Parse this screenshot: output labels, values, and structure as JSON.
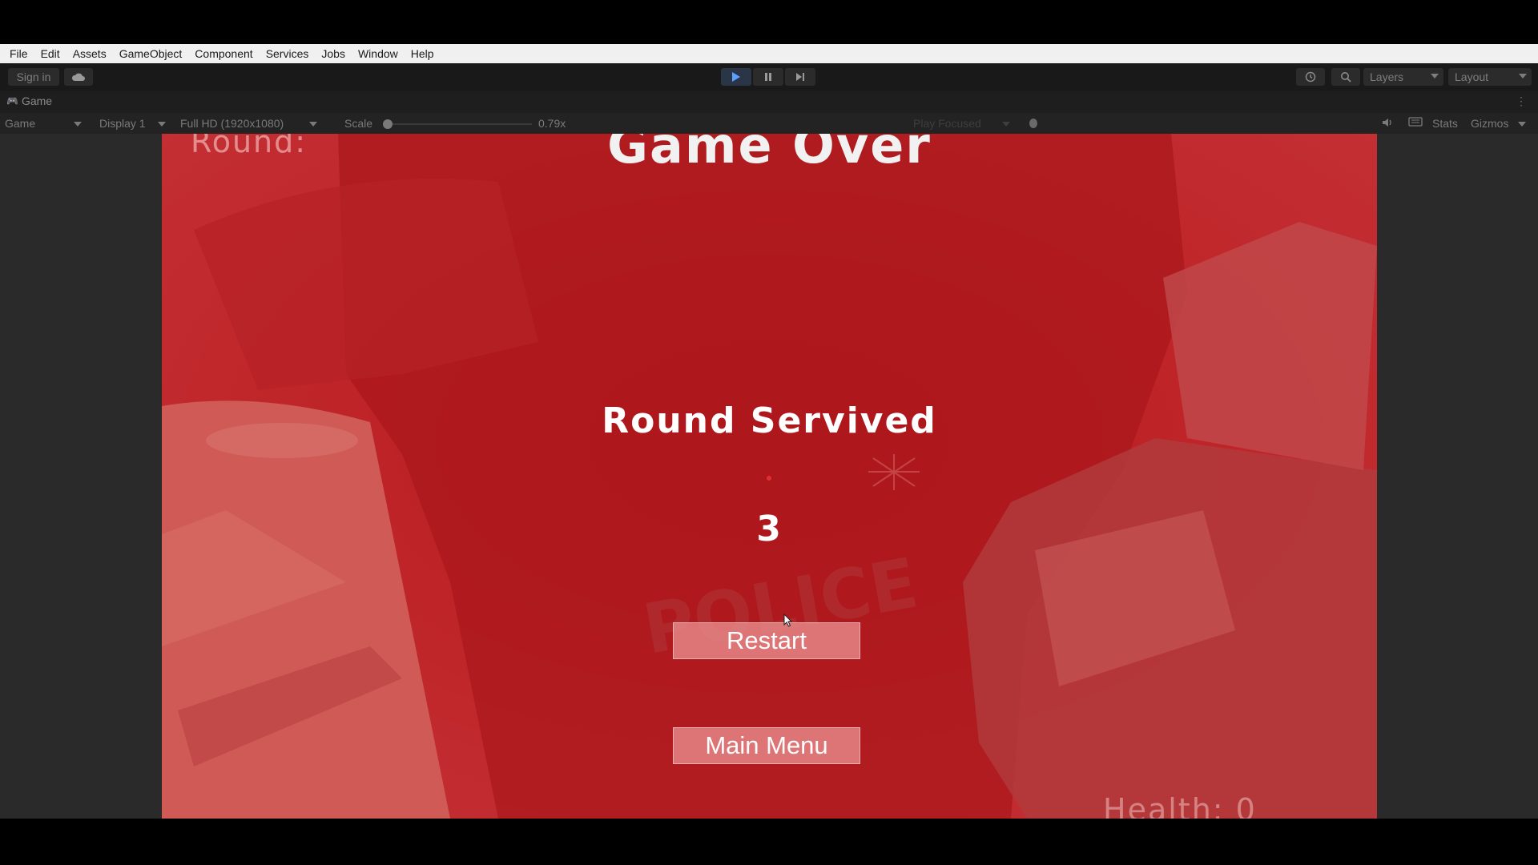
{
  "menubar": {
    "items": [
      "File",
      "Edit",
      "Assets",
      "GameObject",
      "Component",
      "Services",
      "Jobs",
      "Window",
      "Help"
    ]
  },
  "toolbar": {
    "signin_label": "Sign in",
    "layers_label": "Layers",
    "layout_label": "Layout"
  },
  "tabbar": {
    "tab_label": "Game"
  },
  "controlbar": {
    "mode": "Game",
    "display": "Display 1",
    "resolution": "Full HD (1920x1080)",
    "scale_label": "Scale",
    "scale_value": "0.79x",
    "play_focused": "Play Focused",
    "stats_label": "Stats",
    "gizmos_label": "Gizmos"
  },
  "game": {
    "title": "Game Over",
    "round_label": "Round:",
    "round_survived_label": "Round Servived",
    "round_survived_value": "3",
    "restart_label": "Restart",
    "main_menu_label": "Main Menu",
    "health_label": "Health: 0"
  },
  "colors": {
    "overlay_red": "#bd1f23",
    "play_accent": "#5aa0ff"
  }
}
